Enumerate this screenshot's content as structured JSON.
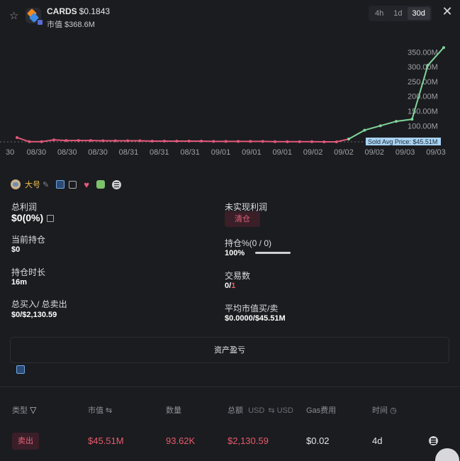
{
  "header": {
    "token": "CARDS",
    "price": "$0.1843",
    "market_cap": "市值 $368.6M",
    "timeframes": [
      "4h",
      "1d",
      "30d"
    ],
    "active_timeframe": "30d",
    "close_icon": "close-icon",
    "star_icon": "star-icon"
  },
  "chart_data": {
    "type": "line",
    "x_ticks": [
      "30",
      "08/30",
      "08/30",
      "08/30",
      "08/31",
      "08/31",
      "08/31",
      "09/01",
      "09/01",
      "09/01",
      "09/02",
      "09/02",
      "09/02",
      "09/03",
      "09/03"
    ],
    "y_ticks": [
      "350.00M",
      "300.00M",
      "250.00M",
      "200.00M",
      "150.00M",
      "100.00M"
    ],
    "ylim": [
      45.51,
      370
    ],
    "reference_line": {
      "label": "Sold Avg Price: $45.51M",
      "value": 45.51
    },
    "series": [
      {
        "color": "#e2587a",
        "values": [
          60,
          46,
          46,
          52,
          50,
          50,
          50,
          49,
          49,
          49,
          49,
          48,
          48,
          48,
          48,
          48,
          47,
          47,
          47,
          47,
          47,
          46,
          46,
          46,
          46,
          45.51,
          45.51,
          55
        ]
      },
      {
        "color": "#7fd49a",
        "values": [
          55,
          85,
          100,
          115,
          122,
          305,
          365
        ]
      }
    ]
  },
  "profile": {
    "nickname": "大号",
    "icons": [
      "avatar",
      "edit-icon",
      "square-icon",
      "copy-icon",
      "heart-icon",
      "frog-icon",
      "menu-icon"
    ]
  },
  "stats": {
    "total_profit_label": "总利润",
    "total_profit_value": "$0(0%)",
    "unrealized_label": "未实现利润",
    "clear_button": "清仓",
    "holding_label": "当前持仓",
    "holding_value": "$0",
    "holding_pct_label": "持仓%(0 / 0)",
    "holding_pct_value": "100%",
    "holding_pct_fraction": 1.0,
    "duration_label": "持仓时长",
    "duration_value": "16m",
    "trades_label": "交易数",
    "trades_buy": "0/",
    "trades_sell": "1",
    "buy_sell_label": "总买入/ 总卖出",
    "buy_sell_value": "$0/$2,130.59",
    "avg_mcap_label": "平均市值买/卖",
    "avg_mcap_value": "$0.0000/$45.51M"
  },
  "pnl_button": "资产盈亏",
  "table": {
    "headers": {
      "type": "类型",
      "mcap": "市值 ⇆",
      "amount": "数量",
      "total": "总额",
      "usd1": "USD",
      "usd2": "USD",
      "gas": "Gas费用",
      "time": "时间"
    },
    "rows": [
      {
        "type": "卖出",
        "mcap": "$45.51M",
        "amount": "93.62K",
        "total": "$2,130.59",
        "gas": "$0.02",
        "time": "4d"
      }
    ]
  }
}
